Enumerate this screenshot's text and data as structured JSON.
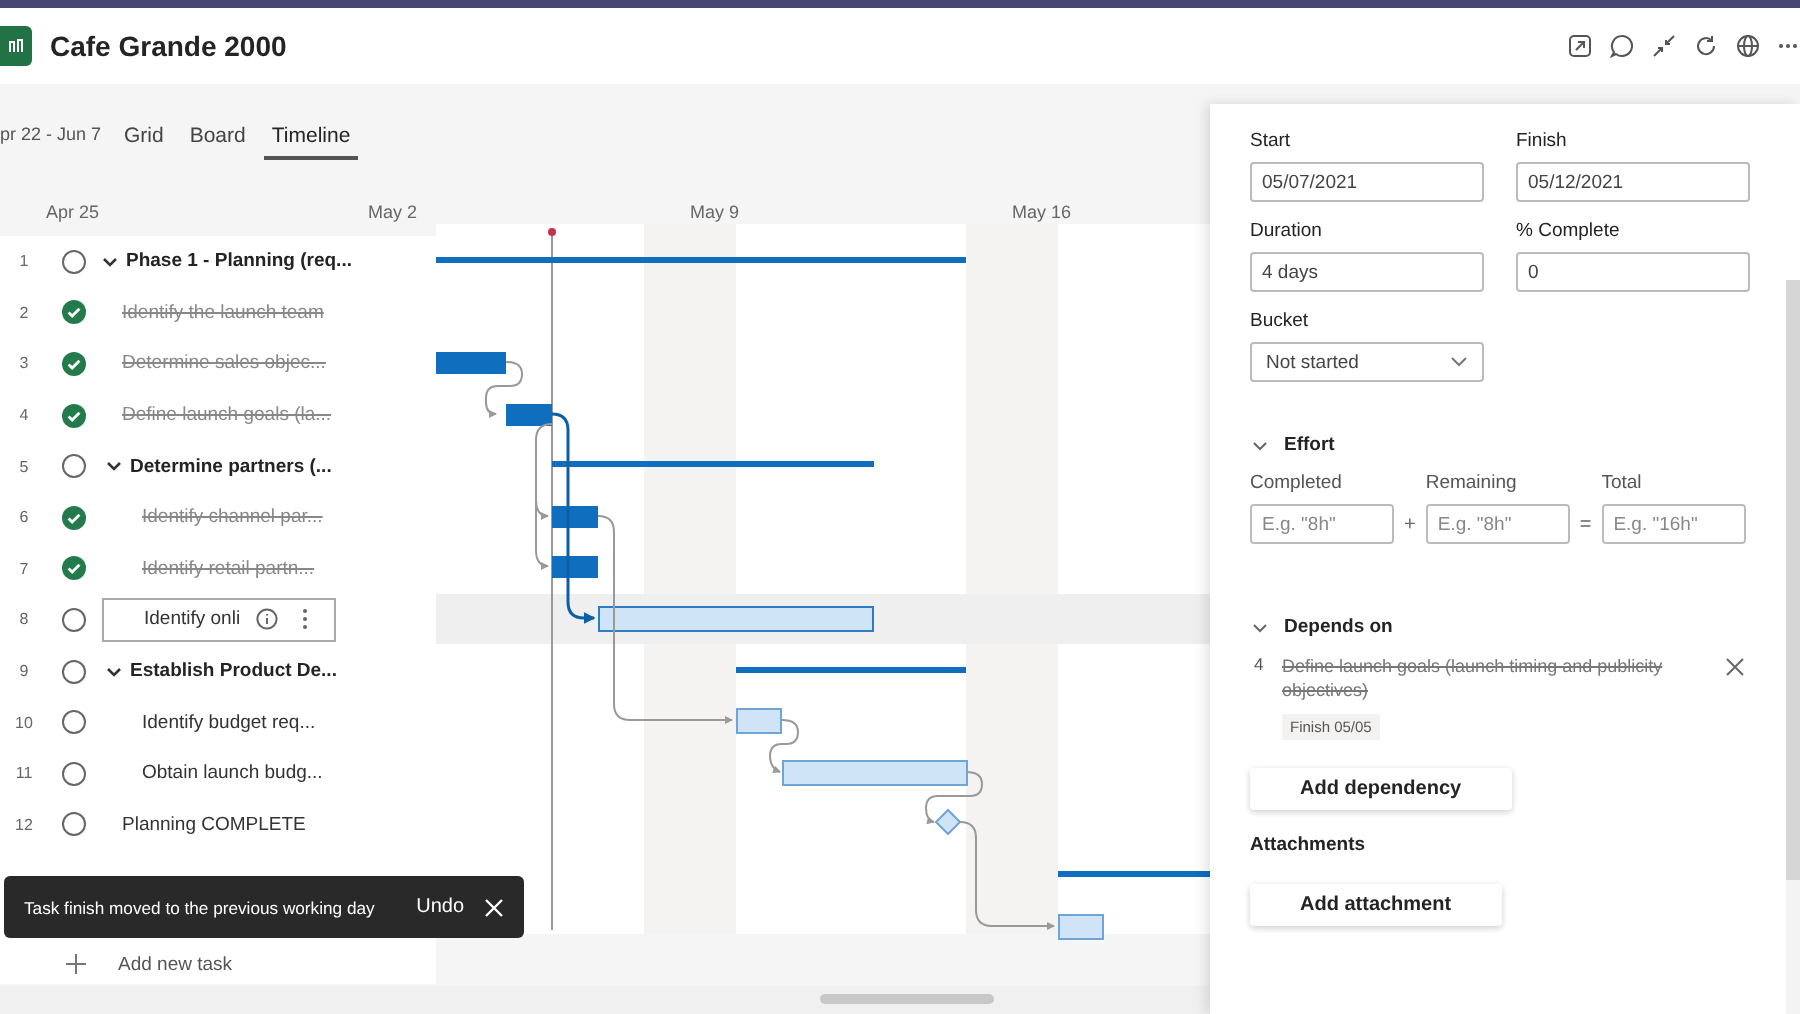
{
  "app": {
    "title": "Cafe Grande 2000"
  },
  "toolbar": {
    "date_range": "pr 22 - Jun 7",
    "tabs": [
      {
        "label": "Grid",
        "selected": false
      },
      {
        "label": "Board",
        "selected": false
      },
      {
        "label": "Timeline",
        "selected": true
      }
    ]
  },
  "timeline_header": [
    "Apr 25",
    "May 2",
    "May 9",
    "May 16"
  ],
  "tasks": [
    {
      "number": "1",
      "title": "Phase 1 - Planning (req...",
      "kind": "summary",
      "completed": false,
      "selected": false,
      "expanded": true,
      "children": [
        {
          "number": "2",
          "title": "Identify the launch team",
          "kind": "task",
          "completed": true,
          "selected": false
        },
        {
          "number": "3",
          "title": "Determine sales objec...",
          "kind": "task",
          "completed": true,
          "selected": false
        },
        {
          "number": "4",
          "title": "Define launch goals (la...",
          "kind": "task",
          "completed": true,
          "selected": false
        },
        {
          "number": "5",
          "title": "Determine partners (...",
          "kind": "summary",
          "completed": false,
          "selected": false,
          "expanded": true,
          "children": [
            {
              "number": "6",
              "title": "Identify channel par...",
              "kind": "task",
              "completed": true,
              "selected": false
            },
            {
              "number": "7",
              "title": "Identify retail partn...",
              "kind": "task",
              "completed": true,
              "selected": false
            },
            {
              "number": "8",
              "title": "Identify onli",
              "kind": "task",
              "completed": false,
              "selected": true
            }
          ]
        },
        {
          "number": "9",
          "title": "Establish Product De...",
          "kind": "summary",
          "completed": false,
          "selected": false,
          "expanded": true,
          "children": [
            {
              "number": "10",
              "title": "Identify budget req...",
              "kind": "task",
              "completed": false,
              "selected": false
            },
            {
              "number": "11",
              "title": "Obtain launch budg...",
              "kind": "task",
              "completed": false,
              "selected": false
            }
          ]
        },
        {
          "number": "12",
          "title": "Planning COMPLETE",
          "kind": "task",
          "completed": false,
          "selected": false
        }
      ]
    }
  ],
  "add_task": "Add new task",
  "toast": {
    "message": "Task finish moved to the previous working day",
    "action": "Undo"
  },
  "details": {
    "fields": [
      {
        "label": "Start",
        "value": "05/07/2021"
      },
      {
        "label": "Finish",
        "value": "05/12/2021"
      },
      {
        "label": "Duration",
        "value": "4 days"
      },
      {
        "label": "% Complete",
        "value": "0"
      }
    ],
    "bucket": {
      "label": "Bucket",
      "value": "Not started"
    },
    "effort": {
      "title": "Effort",
      "expanded": true,
      "inputs": [
        {
          "label": "Completed",
          "placeholder": "E.g. \"8h\""
        },
        {
          "label": "Remaining",
          "placeholder": "E.g. \"8h\""
        },
        {
          "label": "Total",
          "placeholder": "E.g. \"16h\""
        }
      ],
      "operators": [
        "+",
        "="
      ]
    },
    "depends_on": {
      "title": "Depends on",
      "expanded": true,
      "items": [
        {
          "number": "4",
          "title": "Define launch goals (launch timing and publicity objectives)",
          "completed": true,
          "finish": "Finish 05/05"
        }
      ],
      "button": "Add dependency"
    },
    "attachments": {
      "title": "Attachments",
      "button": "Add attachment"
    }
  }
}
